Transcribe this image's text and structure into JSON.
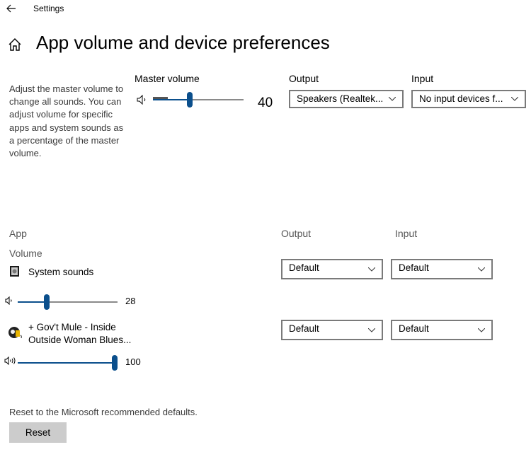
{
  "titlebar": {
    "title": "Settings",
    "back_icon": "arrow-left-icon"
  },
  "header": {
    "title": "App volume and device preferences",
    "home_icon": "home-icon"
  },
  "description": "Adjust the master volume to change all sounds. You can adjust volume for specific apps and system sounds as a percentage of the master volume.",
  "master": {
    "label": "Master volume",
    "value": "40",
    "value_num": 40,
    "speaker_icon": "speaker-icon",
    "output_label": "Output",
    "output_value": "Speakers (Realtek...",
    "input_label": "Input",
    "input_value": "No input devices f..."
  },
  "apps_header": {
    "app_label": "App",
    "volume_label": "Volume",
    "output_label": "Output",
    "input_label": "Input"
  },
  "apps": [
    {
      "name": "System sounds",
      "icon": "system-sounds-icon",
      "volume": "28",
      "volume_num": 28,
      "output": "Default",
      "input": "Default"
    },
    {
      "name_line1": "+ Gov't Mule - Inside",
      "name_line2": "Outside Woman Blues...",
      "icon": "winamp-icon",
      "volume": "100",
      "volume_num": 100,
      "output": "Default",
      "input": "Default"
    }
  ],
  "reset": {
    "text": "Reset to the Microsoft recommended defaults.",
    "button": "Reset"
  },
  "colors": {
    "accent": "#0b4f8c",
    "track": "#8a8a8a",
    "button_bg": "#cccccc"
  }
}
